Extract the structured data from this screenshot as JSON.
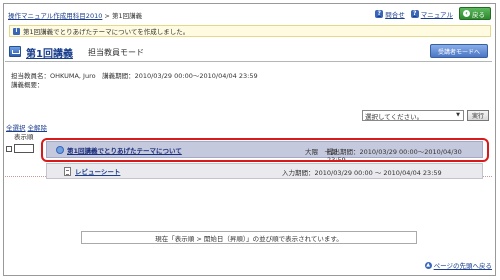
{
  "breadcrumb": {
    "parent": "操作マニュアル作成用科目2010",
    "separator": " > ",
    "current": "第1回講義"
  },
  "toplinks": {
    "contact_label": "問合せ",
    "manual_label": "マニュアル",
    "back_label": "戻る"
  },
  "notice": {
    "text": "第1回講義でとりあげたテーマについてを作成しました。"
  },
  "header": {
    "title": "第1回講義",
    "mode": "担当教員モード",
    "student_mode_button": "受講者モードへ"
  },
  "meta": {
    "teacher_line": "担当教員名：OHKUMA, Juro　講義期間：2010/03/29 00:00～2010/04/04 23:59",
    "summary_label": "講義概要："
  },
  "controls": {
    "select_value": "選択してください。",
    "run_label": "実行",
    "select_all": "全選択",
    "deselect_all": "全解除",
    "order_label": "表示順"
  },
  "rows": [
    {
      "title": "第1回講義でとりあげたテーマについて",
      "teacher": "大隈　十郎",
      "period": "提出期間：2010/03/29 00:00～2010/04/30 23:59"
    },
    {
      "title": "レビューシート",
      "period": "入力期間：2010/03/29 00:00 ～ 2010/04/04 23:59"
    }
  ],
  "footer": {
    "note": "現在「表示順 > 開始日（昇順）」の並び順で表示されています。",
    "page_top": "ページの先頭へ戻る"
  }
}
